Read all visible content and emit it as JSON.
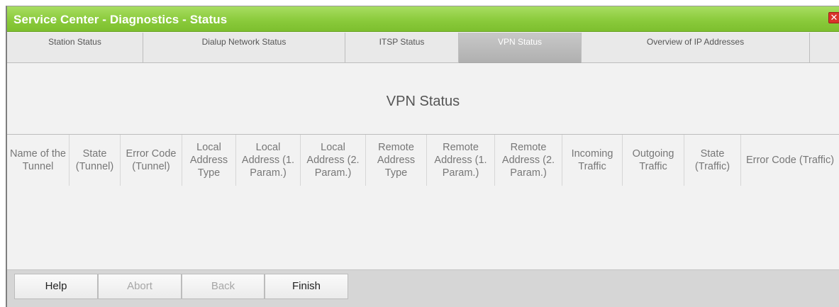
{
  "window": {
    "title": "Service Center - Diagnostics - Status",
    "close_glyph": "✕"
  },
  "tabs": [
    {
      "label": "Station Status",
      "active": false
    },
    {
      "label": "Dialup Network Status",
      "active": false
    },
    {
      "label": "ITSP Status",
      "active": false
    },
    {
      "label": "VPN Status",
      "active": true
    },
    {
      "label": "Overview of IP Addresses",
      "active": false
    }
  ],
  "main": {
    "section_title": "VPN Status",
    "columns": [
      "Name of the Tunnel",
      "State (Tunnel)",
      "Error Code (Tunnel)",
      "Local Address Type",
      "Local Address (1. Param.)",
      "Local Address (2. Param.)",
      "Remote Address Type",
      "Remote Address (1. Param.)",
      "Remote Address (2. Param.)",
      "Incoming Traffic",
      "Outgoing Traffic",
      "State (Traffic)",
      "Error Code (Traffic)"
    ],
    "rows": []
  },
  "footer": {
    "buttons": [
      {
        "label": "Help",
        "enabled": true
      },
      {
        "label": "Abort",
        "enabled": false
      },
      {
        "label": "Back",
        "enabled": false
      },
      {
        "label": "Finish",
        "enabled": true
      }
    ]
  },
  "colors": {
    "titlebar_green": "#8bcb3c",
    "active_tab": "#b8b8b8",
    "close_red": "#d9342b"
  }
}
